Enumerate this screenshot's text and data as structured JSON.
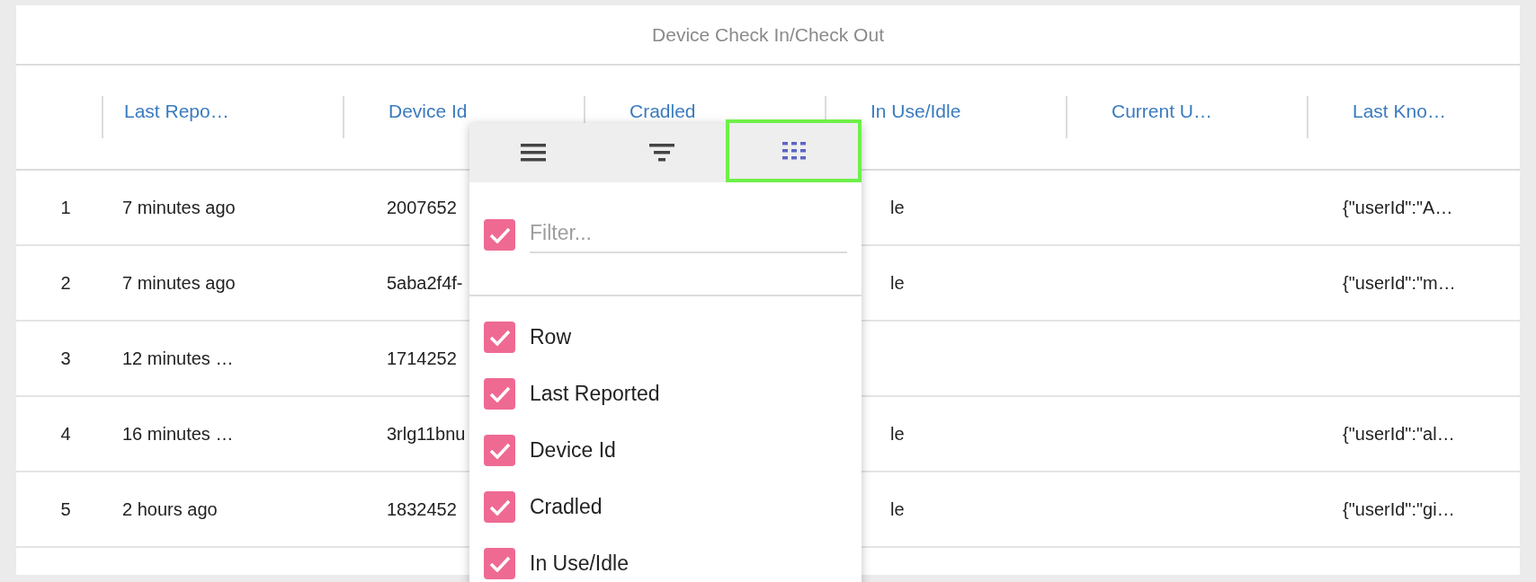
{
  "title": "Device Check In/Check Out",
  "columns": [
    {},
    {
      "label": "Last Repo…"
    },
    {
      "label": "Device Id"
    },
    {
      "label": "Cradled"
    },
    {
      "label": "In Use/Idle"
    },
    {
      "label": "Current U…"
    },
    {
      "label": "Last Kno…"
    }
  ],
  "rows": [
    {
      "cells": [
        "1",
        "7 minutes ago",
        "2007652",
        "",
        "le",
        "",
        "{\"userId\":\"A…"
      ]
    },
    {
      "cells": [
        "2",
        "7 minutes ago",
        "5aba2f4f-",
        "",
        "le",
        "",
        "{\"userId\":\"m…"
      ]
    },
    {
      "cells": [
        "3",
        "12 minutes …",
        "1714252",
        "",
        "",
        "",
        ""
      ]
    },
    {
      "cells": [
        "4",
        "16 minutes …",
        "3rlg11bnu",
        "",
        "le",
        "",
        "{\"userId\":\"al…"
      ]
    },
    {
      "cells": [
        "5",
        "2 hours ago",
        "1832452",
        "",
        "le",
        "",
        "{\"userId\":\"gi…"
      ]
    }
  ],
  "column_menu": {
    "tabs": [
      {
        "kind": "menu",
        "selected": false
      },
      {
        "kind": "filter",
        "selected": false
      },
      {
        "kind": "columns",
        "selected": true
      }
    ],
    "select_all": {
      "checked": true
    },
    "filter": {
      "placeholder": "Filter..."
    },
    "items": [
      {
        "label": "Row",
        "checked": true
      },
      {
        "label": "Last Reported",
        "checked": true
      },
      {
        "label": "Device Id",
        "checked": true
      },
      {
        "label": "Cradled",
        "checked": true
      },
      {
        "label": "In Use/Idle",
        "checked": true
      }
    ]
  }
}
